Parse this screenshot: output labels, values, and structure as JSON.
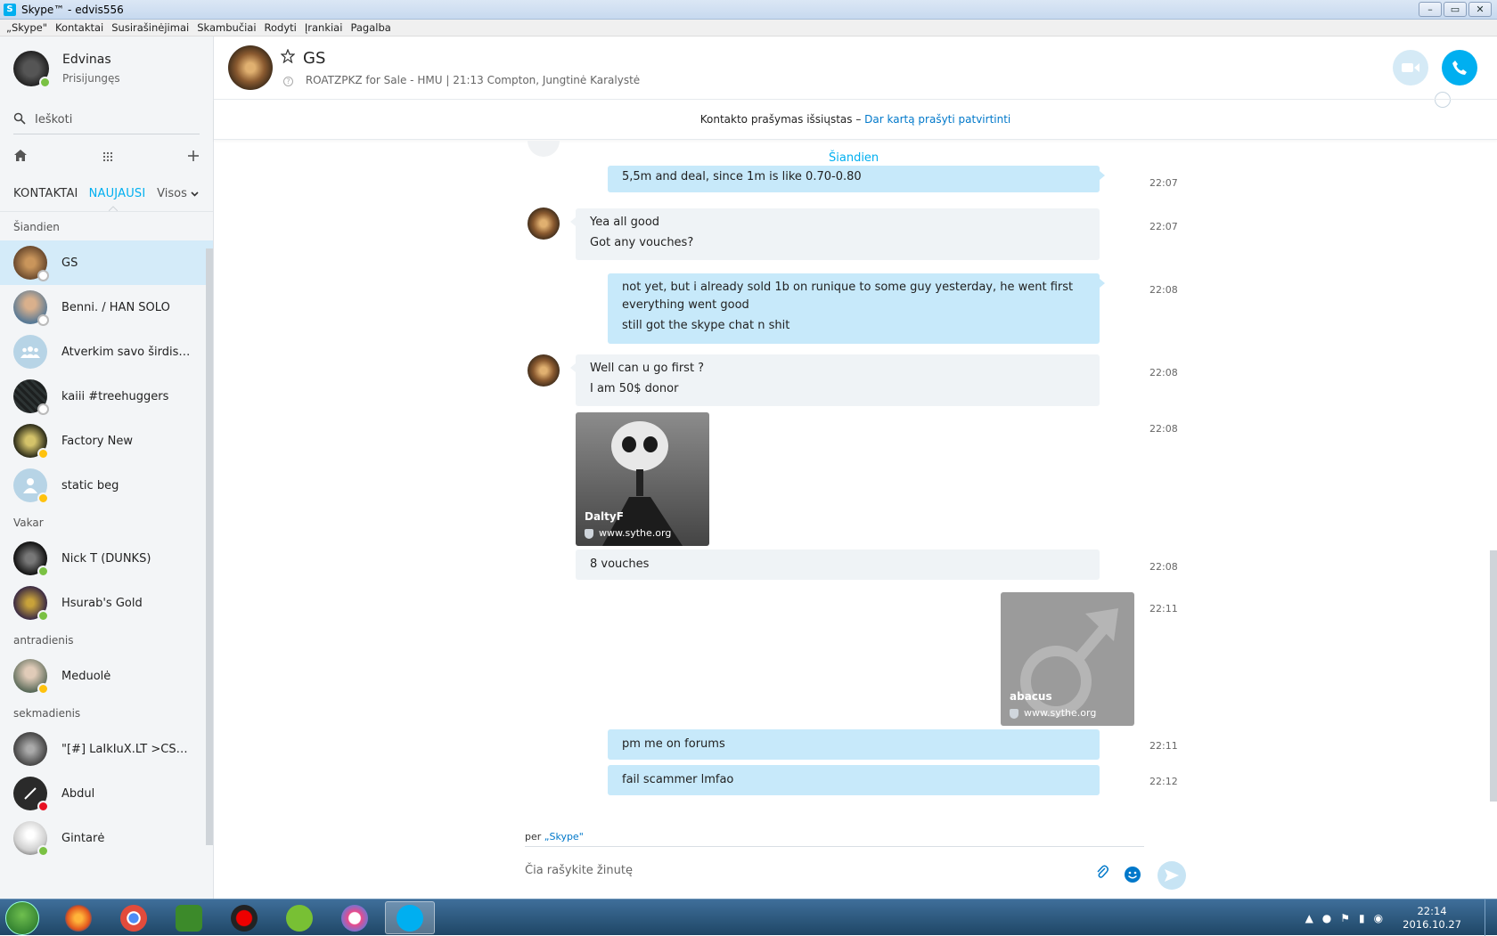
{
  "window": {
    "title": "Skype™ - edvis556",
    "app_icon_letter": "S",
    "minimize": "–",
    "maximize": "▭",
    "close": "✕"
  },
  "menu": [
    "„Skype\"",
    "Kontaktai",
    "Susirašinėjimai",
    "Skambučiai",
    "Rodyti",
    "Įrankiai",
    "Pagalba"
  ],
  "profile": {
    "name": "Edvinas",
    "status": "Prisijungęs"
  },
  "search": {
    "placeholder": "Ieškoti"
  },
  "sidebar_tabs": {
    "contacts": "KONTAKTAI",
    "recent": "NAUJAUSI",
    "filter": "Visos"
  },
  "sections": {
    "today": "Šiandien",
    "yesterday": "Vakar",
    "tuesday": "antradienis",
    "sunday": "sekmadienis"
  },
  "contacts": [
    {
      "name": "GS",
      "status": "unknown",
      "color": "#6b4a2e"
    },
    {
      "name": "Benni. / HAN SOLO",
      "status": "unknown",
      "color": "#8a6a4f"
    },
    {
      "name": "Atverkim savo širdis, p...",
      "status": "none",
      "color": "#b7d4e6"
    },
    {
      "name": "kaiii #treehuggers",
      "status": "unknown",
      "color": "#1d2020"
    },
    {
      "name": "Factory New",
      "status": "away",
      "color": "#2a2a18"
    },
    {
      "name": "static beg",
      "status": "away",
      "color": "#b7d4e6"
    },
    {
      "name": "Nick T (DUNKS)",
      "status": "online",
      "color": "#222222"
    },
    {
      "name": "Hsurab's Gold",
      "status": "online",
      "color": "#3a2a44"
    },
    {
      "name": "Meduolė",
      "status": "away",
      "color": "#a3b3a3"
    },
    {
      "name": "\"[#] LaIkIuX.LT >CS 1.6...",
      "status": "none",
      "color": "#555555"
    },
    {
      "name": "Abdul",
      "status": "busy",
      "color": "#2a2a2a"
    },
    {
      "name": "Gintarė",
      "status": "online",
      "color": "#e5e5e5"
    }
  ],
  "conversation": {
    "name": "GS",
    "mood": "ROATZPKZ for Sale - HMU",
    "local_time": "21:13 Compton, Jungtinė Karalystė",
    "notice_text": "Kontakto prašymas išsiųstas – ",
    "notice_link": "Dar kartą prašyti patvirtinti",
    "day_label": "Šiandien"
  },
  "messages": {
    "m1": {
      "text": "5,5m and deal, since 1m is like 0.70-0.80",
      "time": "22:07"
    },
    "m2": {
      "lines": [
        "Yea all good",
        "Got any vouches?"
      ],
      "time": "22:07"
    },
    "m3": {
      "lines": [
        "not yet, but i already sold 1b on runique to some guy yesterday, he went first everything went good",
        "still got the skype chat n shit"
      ],
      "time": "22:08"
    },
    "m4": {
      "lines": [
        "Well can u go first ?",
        "I am 50$ donor"
      ],
      "time": "22:08"
    },
    "m5": {
      "title": "DaltyF",
      "url": "www.sythe.org",
      "time": "22:08"
    },
    "m6": {
      "text": "8 vouches",
      "time": "22:08"
    },
    "m7": {
      "title": "abacus",
      "url": "www.sythe.org",
      "time": "22:11"
    },
    "m8": {
      "text": "pm me on forums",
      "time": "22:11"
    },
    "m9": {
      "text": "fail scammer lmfao",
      "time": "22:12"
    }
  },
  "composer": {
    "via_prefix": "per ",
    "via_link": "„Skype\"",
    "placeholder": "Čia rašykite žinutę"
  },
  "taskbar": {
    "clock_time": "22:14",
    "clock_date": "2016.10.27"
  },
  "colors": {
    "accent": "#00aff0",
    "bubble_out": "#c7e9fa",
    "bubble_in": "#eff3f6",
    "selected_row": "#d4ebf9"
  }
}
